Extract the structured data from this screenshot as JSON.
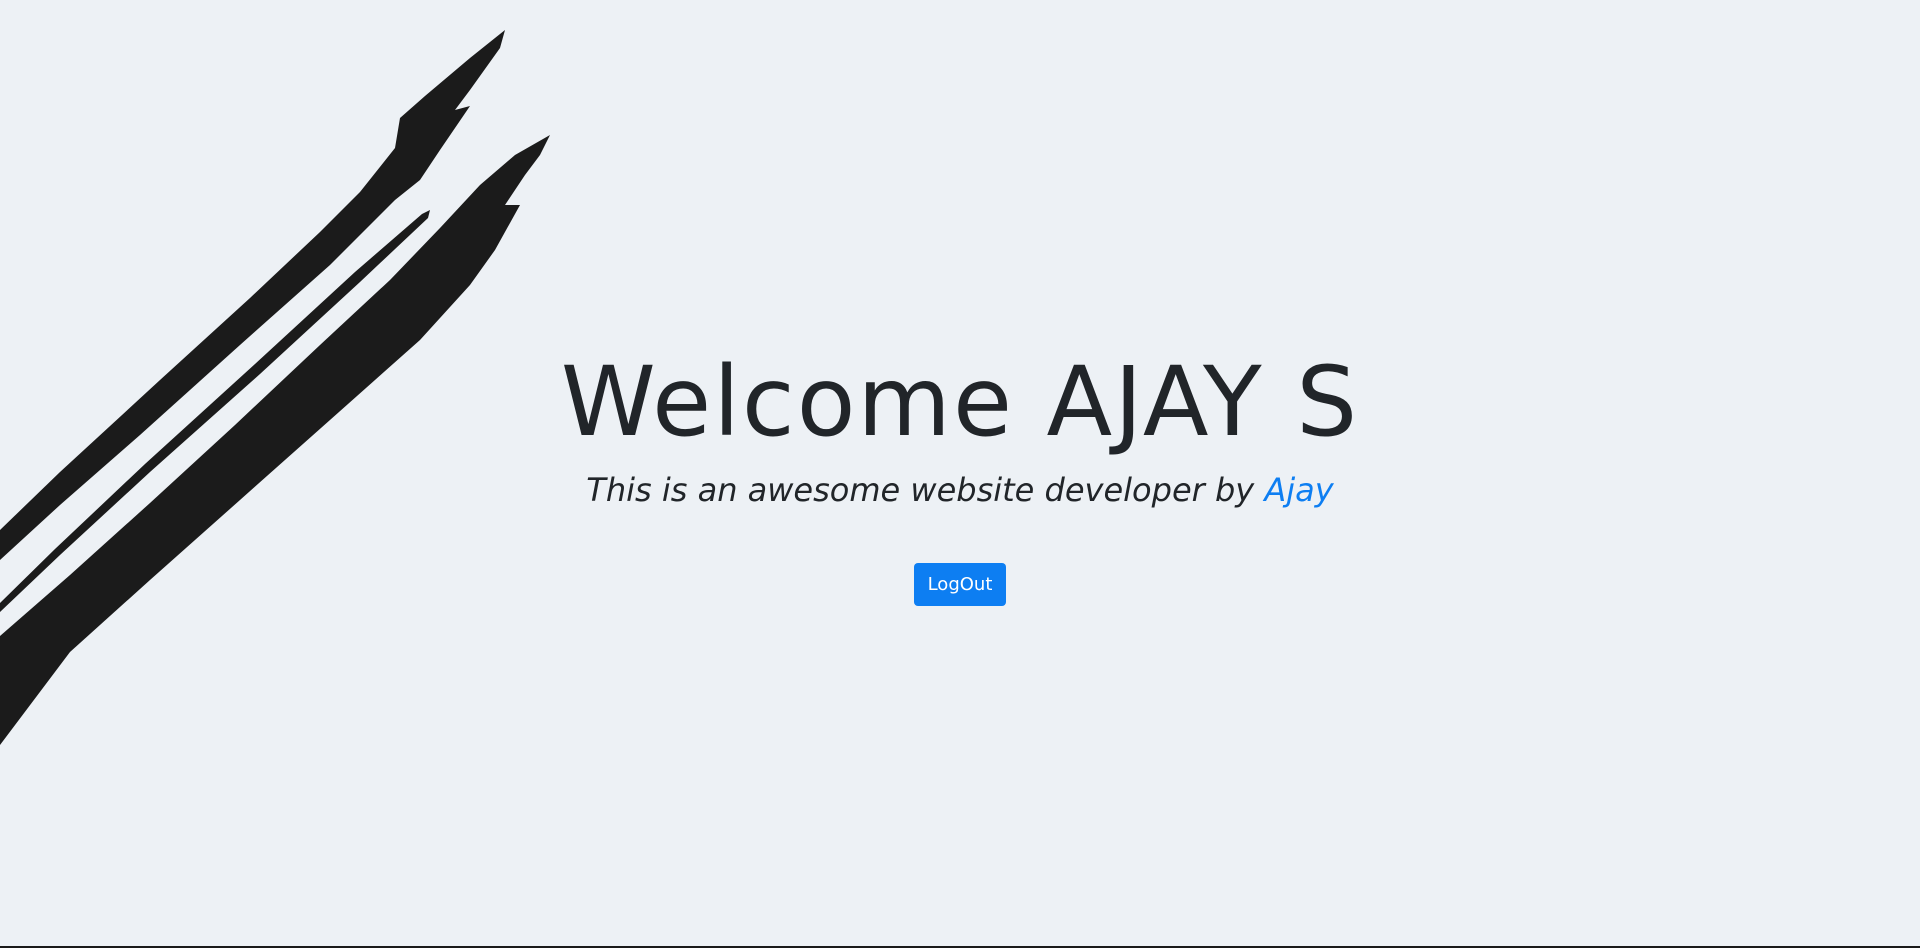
{
  "hero": {
    "title": "Welcome AJAY S",
    "subtitle_text": "This is an awesome website developer by",
    "author_name": "Ajay"
  },
  "actions": {
    "logout_label": "LogOut"
  },
  "decoration": {
    "brush_icon": "brush-stroke-art",
    "brush_color": "#1b1b1b"
  },
  "colors": {
    "background": "#edf1f5",
    "accent": "#0d7ef2",
    "text": "#212529"
  }
}
